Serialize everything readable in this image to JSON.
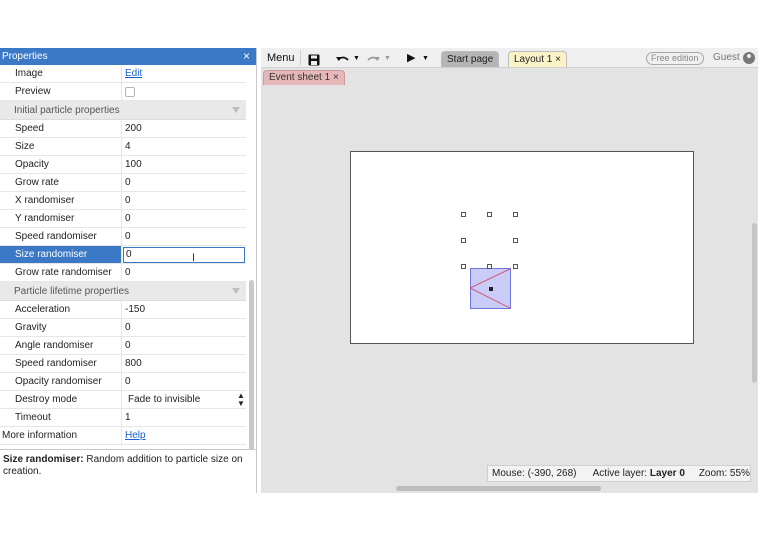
{
  "properties": {
    "title": "Properties",
    "close_symbol": "×",
    "rows": [
      {
        "key": "Image",
        "value": "Edit"
      },
      {
        "key": "Preview",
        "value": ""
      }
    ],
    "section1": "Initial particle properties",
    "initial": [
      {
        "key": "Speed",
        "value": "200"
      },
      {
        "key": "Size",
        "value": "4"
      },
      {
        "key": "Opacity",
        "value": "100"
      },
      {
        "key": "Grow rate",
        "value": "0"
      },
      {
        "key": "X randomiser",
        "value": "0"
      },
      {
        "key": "Y randomiser",
        "value": "0"
      },
      {
        "key": "Speed randomiser",
        "value": "0"
      },
      {
        "key": "Size randomiser",
        "value": "0"
      },
      {
        "key": "Grow rate randomiser",
        "value": "0"
      }
    ],
    "section2": "Particle lifetime properties",
    "lifetime": [
      {
        "key": "Acceleration",
        "value": "-150"
      },
      {
        "key": "Gravity",
        "value": "0"
      },
      {
        "key": "Angle randomiser",
        "value": "0"
      },
      {
        "key": "Speed randomiser",
        "value": "800"
      },
      {
        "key": "Opacity randomiser",
        "value": "0"
      },
      {
        "key": "Destroy mode",
        "value": "Fade to invisible"
      },
      {
        "key": "Timeout",
        "value": "1"
      }
    ],
    "more": {
      "key": "More information",
      "value": "Help"
    },
    "description_title": "Size randomiser:",
    "description_text": " Random addition to particle size on creation."
  },
  "toolbar": {
    "menu_label": "Menu",
    "tab_start": "Start page",
    "tab_layout": "Layout 1",
    "tab_event": "Event sheet 1",
    "free_edition": "Free edition",
    "guest": "Guest",
    "close_symbol": "×"
  },
  "status": {
    "mouse": "Mouse: (-390, 268)",
    "active_layer_label": "Active layer: ",
    "active_layer": "Layer 0",
    "zoom": "Zoom: 55%"
  },
  "colors": {
    "accent": "#3b78c5",
    "layout_tab": "#fbf3c8",
    "event_tab": "#e6b7b8",
    "sprite_fill": "#c8ccf6"
  }
}
